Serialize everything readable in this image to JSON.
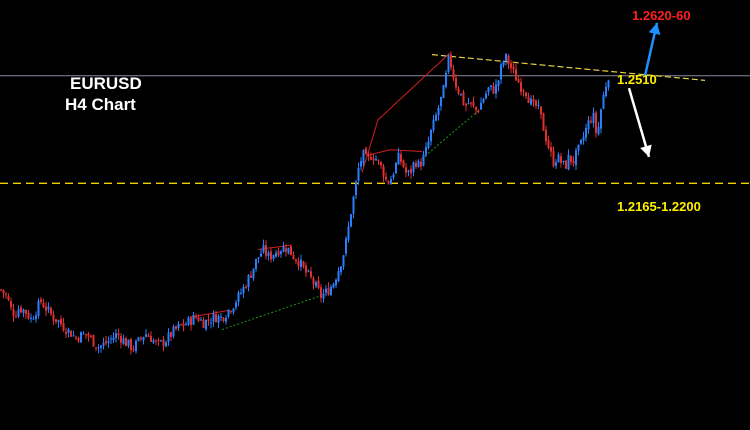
{
  "chart_data": {
    "type": "candlestick",
    "title": "EURUSD",
    "subtitle": "H4 Chart",
    "colors": {
      "background": "#000000",
      "bull": "#2a7fff",
      "bear": "#e03030",
      "hline": "#f0d000",
      "resistance": "#e8d040",
      "target_up_text": "#ff2020",
      "target_up_arrow": "#1e90ff",
      "target_down_arrow": "#ffffff",
      "level_text": "#ffee00",
      "pattern_red": "#d02020",
      "pattern_green": "#1a9a1a"
    },
    "ylim": [
      1.15,
      1.272
    ],
    "path": [
      [
        0,
        1.1898
      ],
      [
        6,
        1.1878
      ],
      [
        10,
        1.1842
      ],
      [
        14,
        1.1828
      ],
      [
        18,
        1.1848
      ],
      [
        24,
        1.1838
      ],
      [
        30,
        1.1815
      ],
      [
        34,
        1.1835
      ],
      [
        40,
        1.1865
      ],
      [
        46,
        1.1842
      ],
      [
        52,
        1.182
      ],
      [
        58,
        1.1808
      ],
      [
        64,
        1.179
      ],
      [
        70,
        1.1775
      ],
      [
        74,
        1.1762
      ],
      [
        80,
        1.1768
      ],
      [
        86,
        1.1772
      ],
      [
        92,
        1.1752
      ],
      [
        98,
        1.1735
      ],
      [
        104,
        1.1745
      ],
      [
        110,
        1.1758
      ],
      [
        116,
        1.1772
      ],
      [
        120,
        1.1762
      ],
      [
        126,
        1.1745
      ],
      [
        132,
        1.1732
      ],
      [
        138,
        1.1752
      ],
      [
        144,
        1.1775
      ],
      [
        150,
        1.1762
      ],
      [
        156,
        1.174
      ],
      [
        160,
        1.1745
      ],
      [
        166,
        1.1758
      ],
      [
        172,
        1.1778
      ],
      [
        178,
        1.1792
      ],
      [
        184,
        1.18
      ],
      [
        190,
        1.1812
      ],
      [
        196,
        1.1822
      ],
      [
        202,
        1.1805
      ],
      [
        208,
        1.1812
      ],
      [
        214,
        1.1822
      ],
      [
        220,
        1.1818
      ],
      [
        226,
        1.1835
      ],
      [
        232,
        1.1855
      ],
      [
        238,
        1.188
      ],
      [
        244,
        1.191
      ],
      [
        250,
        1.1945
      ],
      [
        256,
        1.1985
      ],
      [
        262,
        1.2012
      ],
      [
        268,
        1.199
      ],
      [
        274,
        1.2005
      ],
      [
        280,
        1.2015
      ],
      [
        286,
        1.2018
      ],
      [
        292,
        1.1995
      ],
      [
        298,
        1.1978
      ],
      [
        304,
        1.195
      ],
      [
        310,
        1.1928
      ],
      [
        316,
        1.19
      ],
      [
        320,
        1.188
      ],
      [
        326,
        1.1892
      ],
      [
        332,
        1.1915
      ],
      [
        338,
        1.196
      ],
      [
        342,
        1.1995
      ],
      [
        346,
        1.2045
      ],
      [
        350,
        1.212
      ],
      [
        354,
        1.218
      ],
      [
        358,
        1.225
      ],
      [
        362,
        1.2282
      ],
      [
        366,
        1.2262
      ],
      [
        370,
        1.228
      ],
      [
        374,
        1.2275
      ],
      [
        378,
        1.2255
      ],
      [
        382,
        1.2235
      ],
      [
        386,
        1.22
      ],
      [
        390,
        1.2215
      ],
      [
        394,
        1.2245
      ],
      [
        398,
        1.2275
      ],
      [
        402,
        1.2252
      ],
      [
        406,
        1.2222
      ],
      [
        410,
        1.2235
      ],
      [
        414,
        1.2265
      ],
      [
        418,
        1.225
      ],
      [
        422,
        1.2268
      ],
      [
        426,
        1.23
      ],
      [
        430,
        1.2345
      ],
      [
        434,
        1.238
      ],
      [
        438,
        1.242
      ],
      [
        442,
        1.2455
      ],
      [
        446,
        1.252
      ],
      [
        448,
        1.256
      ],
      [
        452,
        1.251
      ],
      [
        456,
        1.247
      ],
      [
        460,
        1.245
      ],
      [
        464,
        1.2418
      ],
      [
        468,
        1.243
      ],
      [
        472,
        1.2415
      ],
      [
        476,
        1.2405
      ],
      [
        480,
        1.2428
      ],
      [
        484,
        1.245
      ],
      [
        488,
        1.247
      ],
      [
        492,
        1.2465
      ],
      [
        496,
        1.2475
      ],
      [
        500,
        1.2525
      ],
      [
        504,
        1.256
      ],
      [
        508,
        1.254
      ],
      [
        512,
        1.2515
      ],
      [
        516,
        1.2495
      ],
      [
        520,
        1.2475
      ],
      [
        524,
        1.2468
      ],
      [
        528,
        1.244
      ],
      [
        532,
        1.2415
      ],
      [
        536,
        1.242
      ],
      [
        540,
        1.2385
      ],
      [
        544,
        1.234
      ],
      [
        548,
        1.23
      ],
      [
        552,
        1.226
      ],
      [
        556,
        1.2275
      ],
      [
        560,
        1.226
      ],
      [
        564,
        1.2245
      ],
      [
        568,
        1.2275
      ],
      [
        572,
        1.226
      ],
      [
        576,
        1.2285
      ],
      [
        580,
        1.231
      ],
      [
        584,
        1.2345
      ],
      [
        588,
        1.2375
      ],
      [
        592,
        1.2395
      ],
      [
        596,
        1.233
      ],
      [
        600,
        1.241
      ],
      [
        604,
        1.247
      ],
      [
        608,
        1.2512
      ]
    ],
    "resistance_line": {
      "from": [
        432,
        1.2565
      ],
      "to": [
        705,
        1.2492
      ]
    },
    "hlines": [
      {
        "name": "support",
        "value": 1.22,
        "style": "dashed"
      },
      {
        "name": "price",
        "value": 1.2505,
        "style": "solid"
      }
    ],
    "pattern_lines": [
      {
        "color": "red",
        "points": [
          [
            362,
            1.223
          ],
          [
            378,
            1.238
          ],
          [
            450,
            1.257
          ]
        ]
      },
      {
        "color": "red",
        "points": [
          [
            366,
            1.2278
          ],
          [
            390,
            1.2295
          ],
          [
            422,
            1.229
          ]
        ]
      },
      {
        "color": "red",
        "points": [
          [
            190,
            1.182
          ],
          [
            230,
            1.184
          ]
        ]
      },
      {
        "color": "red",
        "points": [
          [
            258,
            1.2012
          ],
          [
            292,
            1.2025
          ]
        ]
      },
      {
        "color": "green",
        "points": [
          [
            222,
            1.1785
          ],
          [
            320,
            1.188
          ]
        ]
      },
      {
        "color": "green",
        "points": [
          [
            422,
            1.227
          ],
          [
            478,
            1.2405
          ]
        ]
      }
    ],
    "arrows": [
      {
        "name": "up-target-arrow",
        "from": [
          645,
          1.2505
        ],
        "to": [
          657,
          1.2655
        ],
        "color": "up"
      },
      {
        "name": "down-target-arrow",
        "from": [
          629,
          1.247
        ],
        "to": [
          649,
          1.2275
        ],
        "color": "down"
      }
    ],
    "annotations": {
      "target_up": "1.2620-60",
      "resistance_level": "1.2510",
      "support_zone": "1.2165-1.2200"
    },
    "grid": false
  }
}
